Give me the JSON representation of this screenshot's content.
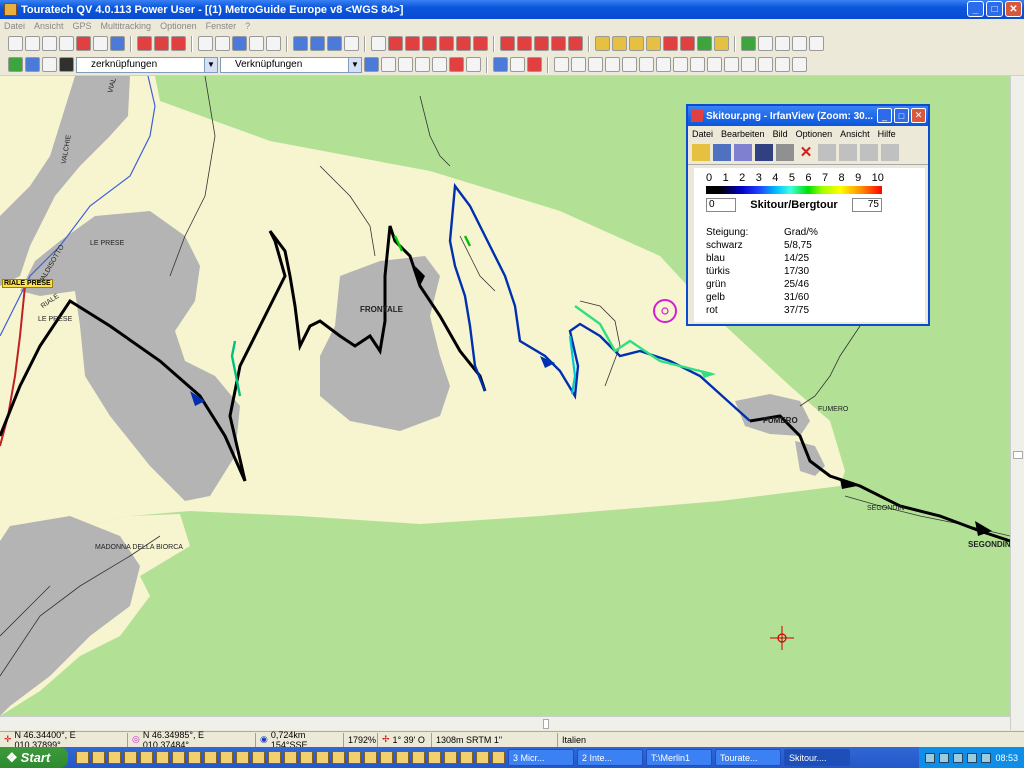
{
  "app": {
    "title": "Touratech QV 4.0.113 Power User - [(1) MetroGuide Europe v8 <WGS 84>]"
  },
  "window_buttons": {
    "minimize": "_",
    "maximize": "□",
    "close": "✕"
  },
  "menubar": [
    "Datei",
    "Ansicht",
    "GPS",
    "Multitracking",
    "Optionen",
    "Fenster",
    "?"
  ],
  "toolbar2": {
    "combo1": "zerknüpfungen",
    "combo2": "Verknüpfungen"
  },
  "map_labels": {
    "le_prese_top": "LE PRESE",
    "le_prese": "LE PRESE",
    "yellow_label": "RIALE PRESE",
    "frontale": "FRONTALE",
    "fumero": "FUMERO",
    "fumero2": "FUMERO",
    "segondin": "SEGONDIN",
    "segondin2": "SEGONDIN",
    "madonna": "MADONNA DELLA BIORCA",
    "vallecchie": "VALCHIE",
    "valdisotto": "VALDISOTTO",
    "vial": "VIAL",
    "riale": "RIALE"
  },
  "irfanview": {
    "title": "Skitour.png - IrfanView (Zoom: 30...",
    "menu": [
      "Datei",
      "Bearbeiten",
      "Bild",
      "Optionen",
      "Ansicht",
      "Hilfe"
    ],
    "scale_numbers": [
      "0",
      "1",
      "2",
      "3",
      "4",
      "5",
      "6",
      "7",
      "8",
      "9",
      "10"
    ],
    "left_value": "0",
    "legend_title": "Skitour/Bergtour",
    "right_value": "75",
    "table_header": [
      "Steigung:",
      "Grad/%"
    ],
    "rows": [
      [
        "schwarz",
        "5/8,75"
      ],
      [
        "blau",
        "14/25"
      ],
      [
        "türkis",
        "17/30"
      ],
      [
        "grün",
        "25/46"
      ],
      [
        "gelb",
        "31/60"
      ],
      [
        "rot",
        "37/75"
      ]
    ]
  },
  "statusbar": {
    "cursor_pos": "N 46.34400°, E 010.37899°",
    "target_pos": "N 46.34985°, E 010.37484°",
    "distance": "0,724km 154°SSE",
    "zoom": "1792%",
    "angle": "1° 39' O",
    "elevation": "1308m SRTM 1\"",
    "country": "Italien"
  },
  "taskbar": {
    "start": "Start",
    "tasks": [
      "3 Micr...",
      "2 Inte...",
      "T:\\Merlin1",
      "Tourate...",
      "Skitour...."
    ],
    "clock": "08:53"
  },
  "colors": {
    "map_green": "#b2e196",
    "map_cream": "#f7f5d0",
    "map_gray": "#b4b4b4"
  }
}
